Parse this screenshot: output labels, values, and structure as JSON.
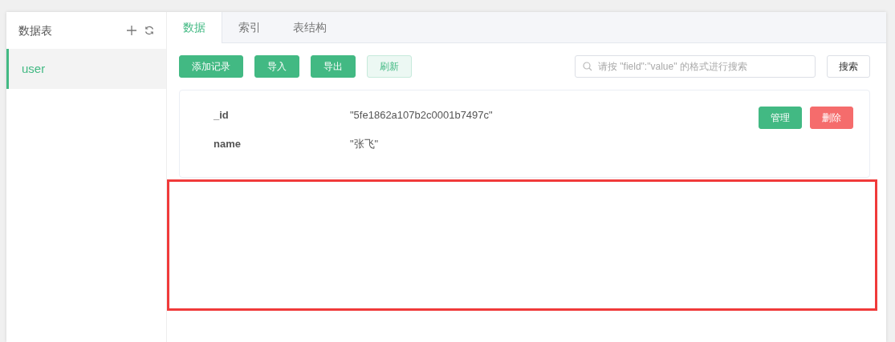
{
  "sidebar": {
    "title": "数据表",
    "items": [
      {
        "label": "user",
        "selected": true
      }
    ]
  },
  "tabs": [
    {
      "label": "数据",
      "selected": true
    },
    {
      "label": "索引",
      "selected": false
    },
    {
      "label": "表结构",
      "selected": false
    }
  ],
  "toolbar": {
    "buttons": [
      {
        "label": "添加记录",
        "kind": "primary"
      },
      {
        "label": "导入",
        "kind": "primary"
      },
      {
        "label": "导出",
        "kind": "primary"
      },
      {
        "label": "刷新",
        "kind": "light"
      }
    ],
    "search": {
      "placeholder": "请按 \"field\":\"value\" 的格式进行搜索"
    },
    "search_button": "搜索"
  },
  "records": [
    {
      "fields": [
        {
          "key": "_id",
          "value": "\"5fe1862a107b2c0001b7497c\""
        },
        {
          "key": "name",
          "value": "\"张飞\""
        }
      ],
      "actions": [
        {
          "label": "管理",
          "kind": "primary"
        },
        {
          "label": "删除",
          "kind": "danger"
        }
      ]
    }
  ]
}
